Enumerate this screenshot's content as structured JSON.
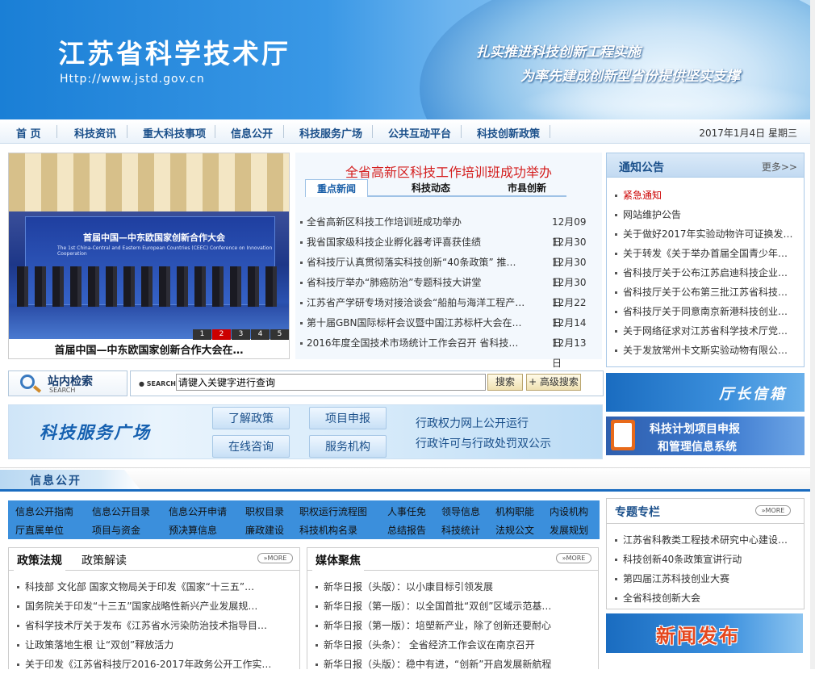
{
  "header": {
    "title": "江苏省科学技术厅",
    "url": "Http://www.jstd.gov.cn",
    "slogan1": "扎实推进科技创新工程实施",
    "slogan2": "为率先建成创新型省份提供坚实支撑"
  },
  "nav": {
    "items": [
      "首 页",
      "科技资讯",
      "重大科技事项",
      "信息公开",
      "科技服务广场",
      "公共互动平台",
      "科技创新政策"
    ],
    "date": "2017年1月4日 星期三"
  },
  "slideshow": {
    "banner_title": "首届中国—中东欧国家创新合作大会",
    "banner_subtitle": "The 1st China-Central and Eastern European Countries (CEEC) Conference on Innovation Cooperation",
    "pages": [
      "1",
      "2",
      "3",
      "4",
      "5"
    ],
    "active_page": "2",
    "caption": "首届中国—中东欧国家创新合作大会在…"
  },
  "news": {
    "headline": "全省高新区科技工作培训班成功举办",
    "tabs": [
      "重点新闻",
      "科技动态",
      "市县创新"
    ],
    "items": [
      {
        "title": "全省高新区科技工作培训班成功举办",
        "date": "12月09日"
      },
      {
        "title": "我省国家级科技企业孵化器考评喜获佳绩",
        "date": "12月30日"
      },
      {
        "title": "省科技厅认真贯彻落实科技创新“40条政策” 推…",
        "date": "12月30日"
      },
      {
        "title": "省科技厅举办“肺癌防治”专题科技大讲堂",
        "date": "12月30日"
      },
      {
        "title": "江苏省产学研专场对接洽谈会“船舶与海洋工程产…",
        "date": "12月22日"
      },
      {
        "title": "第十届GBN国际标杆会议暨中国江苏标杆大会在南…",
        "date": "12月14日"
      },
      {
        "title": "2016年度全国技术市场统计工作会召开 省科技厅…",
        "date": "12月13日"
      }
    ]
  },
  "notice": {
    "title": "通知公告",
    "more": "更多>>",
    "items": [
      "紧急通知",
      "网站维护公告",
      "关于做好2017年实验动物许可证换发…",
      "关于转发《关于举办首届全国青少年…",
      "省科技厅关于公布江苏启迪科技企业…",
      "省科技厅关于公布第三批江苏省科技…",
      "省科技厅关于同意南京新港科技创业…",
      "关于网络征求对江苏省科学技术厅党…",
      "关于发放常州卡文斯实验动物有限公…"
    ]
  },
  "search": {
    "title": "站内检索",
    "subtitle": "SEARCH",
    "label": "● SEARCH：",
    "value": "请键入关键字进行查询",
    "button": "搜索",
    "advanced": "+ 高级搜索"
  },
  "service": {
    "title": "科技服务广场",
    "pills": [
      "了解政策",
      "项目申报",
      "在线咨询",
      "服务机构"
    ],
    "right1": "行政权力网上公开运行",
    "right2": "行政许可与行政处罚双公示"
  },
  "mayor": {
    "title": "厅长信箱"
  },
  "plan": {
    "line1": "科技计划项目申报",
    "line2": "和管理信息系统"
  },
  "info": {
    "title": "信息公开",
    "row1": [
      "信息公开指南",
      "信息公开目录",
      "信息公开申请",
      "职权目录",
      "职权运行流程图",
      "人事任免",
      "领导信息",
      "机构职能",
      "内设机构"
    ],
    "row2": [
      "厅直属单位",
      "项目与资金",
      "预决算信息",
      "廉政建设",
      "科技机构名录",
      "总结报告",
      "科技统计",
      "法规公文",
      "发展规划"
    ]
  },
  "policy": {
    "tabs": [
      "政策法规",
      "政策解读"
    ],
    "more": "MORE",
    "items": [
      "科技部 文化部 国家文物局关于印发《国家“十三五”…",
      "国务院关于印发“十三五”国家战略性新兴产业发展规…",
      "省科学技术厅关于发布《江苏省水污染防治技术指导目…",
      "让政策落地生根 让“双创”释放活力",
      "关于印发《江苏省科技厅2016-2017年政务公开工作实…"
    ]
  },
  "media": {
    "tabs": [
      "媒体聚焦"
    ],
    "more": "MORE",
    "items": [
      "新华日报（头版）：以小康目标引领发展",
      "新华日报（第一版）：以全国首批“双创”区域示范基…",
      "新华日报（第一版）：培塑新产业，除了创新还要耐心",
      "新华日报（头条）： 全省经济工作会议在南京召开",
      "新华日报（头版）：稳中有进，“创新”开启发展新航程"
    ]
  },
  "topic": {
    "title": "专题专栏",
    "more": "MORE",
    "items": [
      "江苏省科教类工程技术研究中心建设…",
      "科技创新40条政策宣讲行动",
      "第四届江苏科技创业大赛",
      "全省科技创新大会"
    ]
  },
  "press": {
    "title": "新闻发布"
  }
}
